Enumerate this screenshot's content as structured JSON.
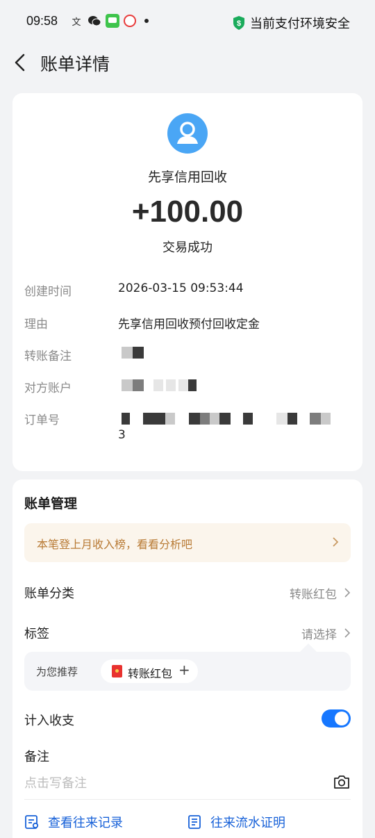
{
  "status_bar": {
    "time": "09:58",
    "icons": [
      "translate-icon",
      "wechat-icon",
      "message-icon",
      "app-icon"
    ],
    "security_text": "当前支付环境安全"
  },
  "header": {
    "title": "账单详情"
  },
  "transaction": {
    "payee": "先享信用回收",
    "amount": "+100.00",
    "status": "交易成功"
  },
  "details": [
    {
      "label": "创建时间",
      "value": "2026-03-15 09:53:44"
    },
    {
      "label": "理由",
      "value": "先享信用回收预付回收定金"
    },
    {
      "label": "转账备注",
      "value": ""
    },
    {
      "label": "对方账户",
      "value": ""
    },
    {
      "label": "订单号",
      "value": "3"
    }
  ],
  "management": {
    "title": "账单管理",
    "promo": "本笔登上月收入榜，看看分析吧",
    "category_label": "账单分类",
    "category_value": "转账红包",
    "tag_label": "标签",
    "tag_value": "请选择",
    "recommend_label": "为您推荐",
    "recommend_chip": "转账红包",
    "include_label": "计入收支",
    "include_enabled": true,
    "note_label": "备注",
    "note_placeholder": "点击写备注",
    "link_history": "查看往来记录",
    "link_proof": "往来流水证明"
  },
  "colors": {
    "accent": "#1677ff",
    "link": "#1660d8",
    "promo_text": "#b87a34",
    "avatar": "#4aa6f5"
  }
}
